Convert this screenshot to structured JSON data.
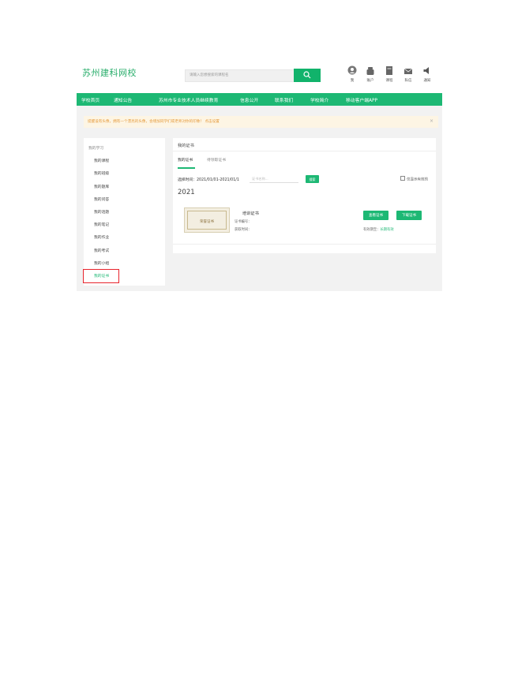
{
  "header": {
    "logo": "苏州建科网校",
    "search_placeholder": "请输入您想搜索的课程名",
    "icons": [
      {
        "icon": "user-icon",
        "label": "我"
      },
      {
        "icon": "account-icon",
        "label": "账户"
      },
      {
        "icon": "course-icon",
        "label": "课程"
      },
      {
        "icon": "mail-icon",
        "label": "私信"
      },
      {
        "icon": "notify-icon",
        "label": "通知"
      }
    ]
  },
  "nav": {
    "items": [
      "学校首页",
      "通知公告",
      "苏州市专业技术人员继续教育",
      "信息公开",
      "联系我们",
      "学校简介",
      "移动客户端APP"
    ]
  },
  "notice": {
    "text": "提醒设有头像，拥有一个漂亮的头像，会增加同学们或老师对你的印象！ 点击设置",
    "close": "×"
  },
  "sidebar": {
    "title": "我的学习",
    "items": [
      "我的课程",
      "我的班级",
      "我的题库",
      "我的问答",
      "我的话题",
      "我的笔记",
      "我的作业",
      "我的考试",
      "我的小组",
      "我的证书"
    ],
    "active_index": 9
  },
  "main": {
    "title": "我的证书",
    "tabs": [
      "我的证书",
      "待领取证书"
    ],
    "active_tab": 0,
    "filter_label": "选择时间：2021/01/01-2021/01/1",
    "cert_input_placeholder": "证书名称...",
    "search_button": "搜索",
    "only_valid_label": "仅显示有效的",
    "year": "2021",
    "certificate": {
      "thumb_text": "荣誉证书",
      "name": "培训证书",
      "number_label": "证书编号：",
      "number_value": "",
      "issue_label": "获取时间：",
      "view_button": "查看证书",
      "download_button": "下载证书",
      "valid_label": "有效期至：",
      "valid_value": "长期有效"
    }
  },
  "colors": {
    "brand_green": "#1db874",
    "highlight_red": "#e8242c",
    "notice_orange": "#e59a3b"
  }
}
